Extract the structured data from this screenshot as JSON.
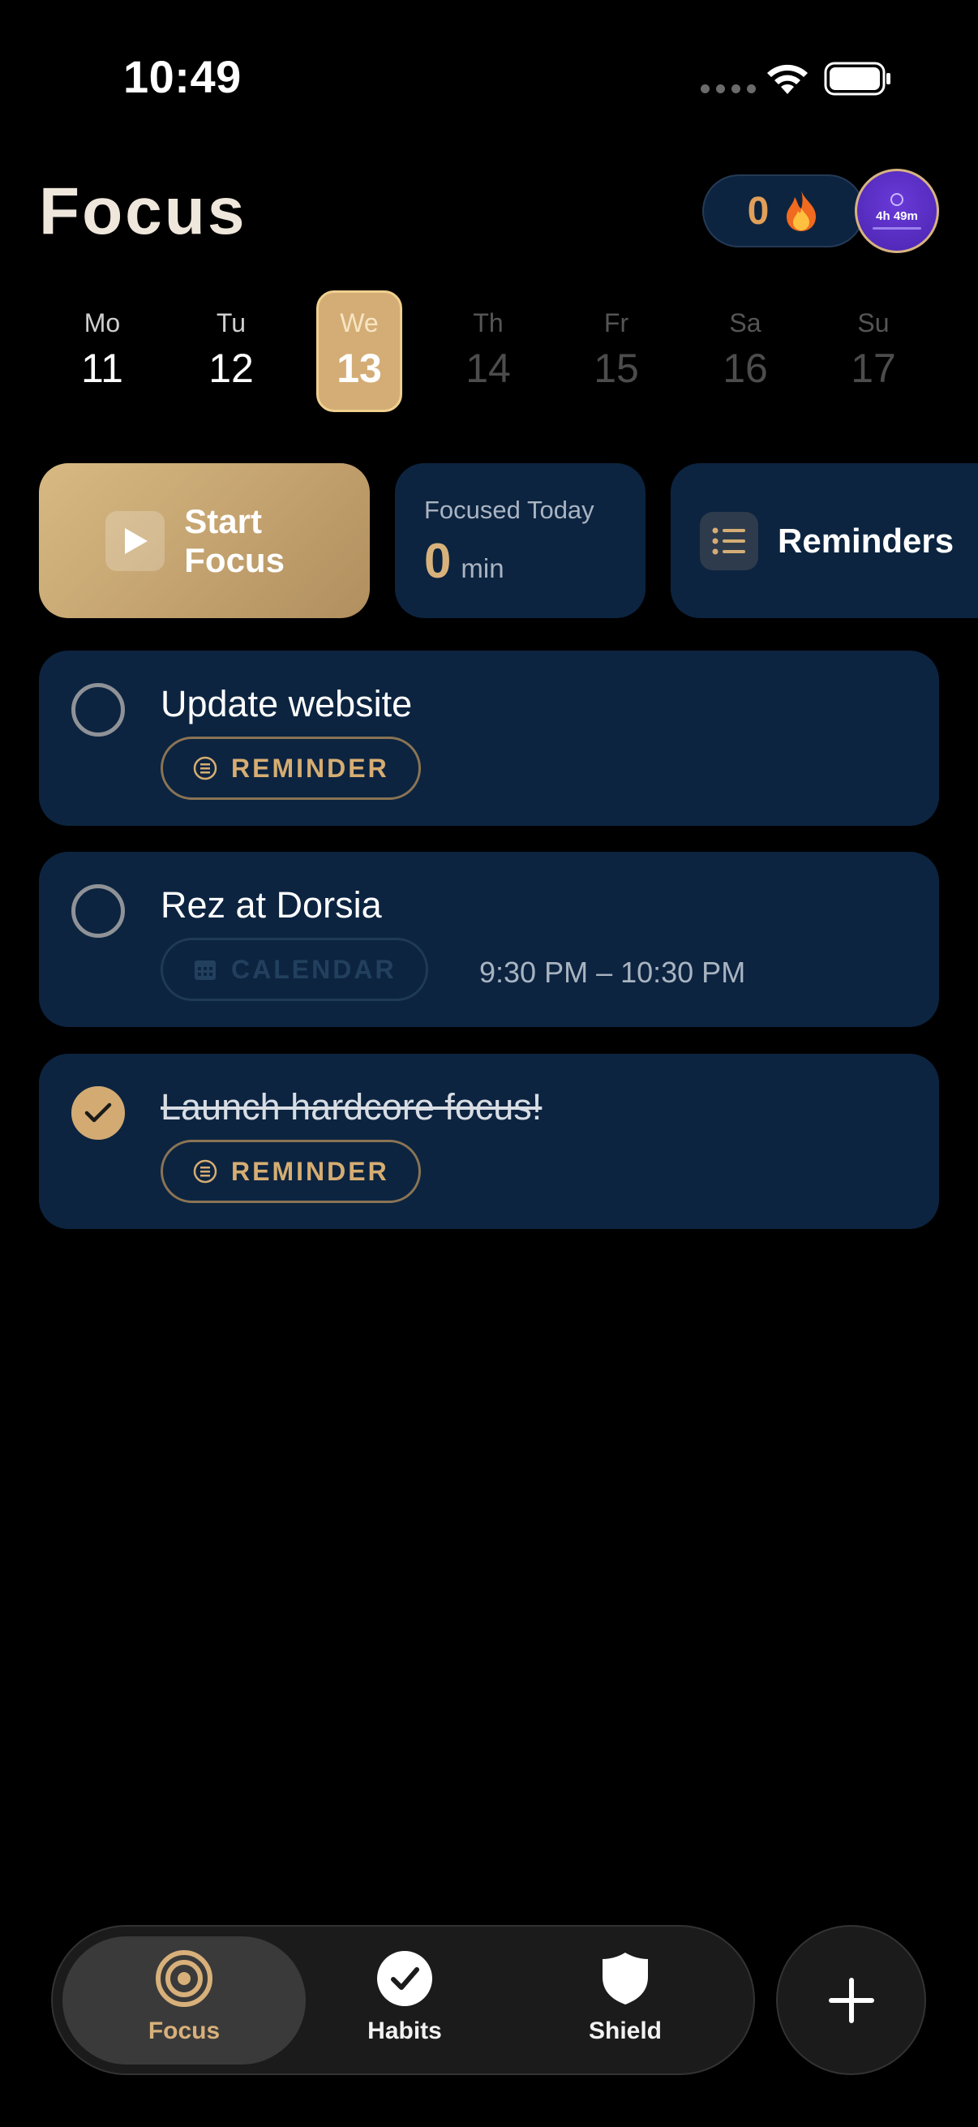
{
  "status_bar": {
    "time": "10:49"
  },
  "header": {
    "title": "Focus",
    "streak_count": "0",
    "avatar_text": "4h 49m"
  },
  "week": {
    "days": [
      {
        "name": "Mo",
        "date": "11"
      },
      {
        "name": "Tu",
        "date": "12"
      },
      {
        "name": "We",
        "date": "13"
      },
      {
        "name": "Th",
        "date": "14"
      },
      {
        "name": "Fr",
        "date": "15"
      },
      {
        "name": "Sa",
        "date": "16"
      },
      {
        "name": "Su",
        "date": "17"
      }
    ],
    "selected": "13"
  },
  "actions": {
    "start_focus_label": "Start Focus",
    "focused_today_label": "Focused Today",
    "focused_today_value": "0",
    "focused_today_unit": "min",
    "reminders_label": "Reminders"
  },
  "tasks": [
    {
      "title": "Update website",
      "tag": "REMINDER",
      "time": "",
      "done": false
    },
    {
      "title": "Rez at Dorsia",
      "tag": "CALENDAR",
      "time": "9:30 PM – 10:30 PM",
      "done": false
    },
    {
      "title": "Launch hardcore focus!",
      "tag": "REMINDER",
      "time": "",
      "done": true
    }
  ],
  "nav": {
    "tabs": [
      {
        "label": "Focus",
        "icon": "target-icon"
      },
      {
        "label": "Habits",
        "icon": "checkmark-circle-icon"
      },
      {
        "label": "Shield",
        "icon": "shield-icon"
      }
    ],
    "active": "Focus",
    "add_icon": "plus-icon"
  },
  "colors": {
    "accent_gold": "#d4ad76",
    "card_navy": "#0c2440",
    "background": "#000000"
  }
}
